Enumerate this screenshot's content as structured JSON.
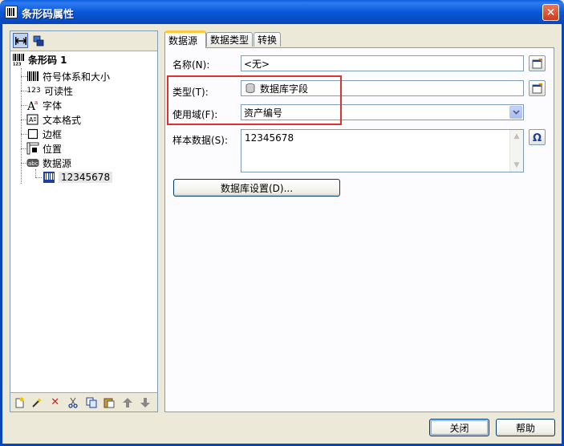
{
  "window": {
    "title": "条形码属性",
    "close_label": "✕"
  },
  "tree": {
    "root": {
      "label": "条形码 1",
      "icon": "barcode-icon"
    },
    "items": [
      {
        "label": "符号体系和大小",
        "icon": "barcode-symbology-icon"
      },
      {
        "label": "可读性",
        "icon": "readability-icon",
        "icon_text": "123"
      },
      {
        "label": "字体",
        "icon": "font-icon"
      },
      {
        "label": "文本格式",
        "icon": "text-format-icon"
      },
      {
        "label": "边框",
        "icon": "border-icon"
      },
      {
        "label": "位置",
        "icon": "position-icon"
      },
      {
        "label": "数据源",
        "icon": "data-source-icon"
      }
    ],
    "child": {
      "label": "12345678",
      "icon": "barcode-data-icon"
    }
  },
  "tabs": [
    {
      "label": "数据源",
      "active": true
    },
    {
      "label": "数据类型",
      "active": false
    },
    {
      "label": "转换",
      "active": false
    }
  ],
  "form": {
    "name_label": "名称(N):",
    "name_value": "<无>",
    "type_label": "类型(T):",
    "type_value": "数据库字段",
    "domain_label": "使用域(F):",
    "domain_value": "资产编号",
    "sample_label": "样本数据(S):",
    "sample_value": "12345678",
    "db_settings_label": "数据库设置(D)..."
  },
  "footer": {
    "close_label": "关闭",
    "help_label": "帮助"
  },
  "colors": {
    "titlebar": "#0a58d8",
    "highlight": "#e03030",
    "tab_accent": "#ffc83c"
  }
}
